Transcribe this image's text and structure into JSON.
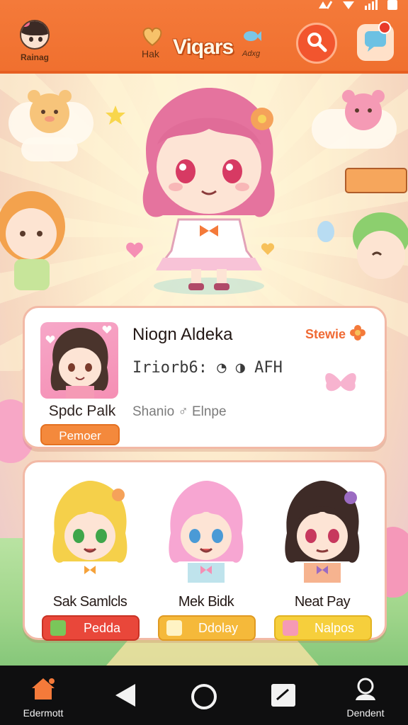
{
  "header": {
    "user_label": "Rainag",
    "app_title": "Viqars",
    "app_sub_left": "Hak",
    "app_sub_right": "Adxg",
    "search_icon": "search-icon",
    "chat_icon": "chat-icon",
    "accent": "#f47a3a"
  },
  "profile_card": {
    "title": "Niogn Aldeka",
    "action_label": "Stewie",
    "status_text": "Iriorb6: ◔ ◑ AFH",
    "tagline": "Shanio ♂ Elnpe",
    "thumb_label": "Spdc Palk",
    "follow_label": "Pemoer"
  },
  "friends": [
    {
      "name": "Sak Samlcls",
      "button_label": "Pedda",
      "hair": "#f5d04a",
      "btn_color": "#e9473a"
    },
    {
      "name": "Mek Bidk",
      "button_label": "Ddolay",
      "hair": "#f7a6d2",
      "btn_color": "#f5b93a"
    },
    {
      "name": "Neat Pay",
      "button_label": "Nalpos",
      "hair": "#3e2b27",
      "btn_color": "#f6cf3c"
    }
  ],
  "nav": {
    "left_label": "Edermott",
    "right_label": "Dendent"
  }
}
